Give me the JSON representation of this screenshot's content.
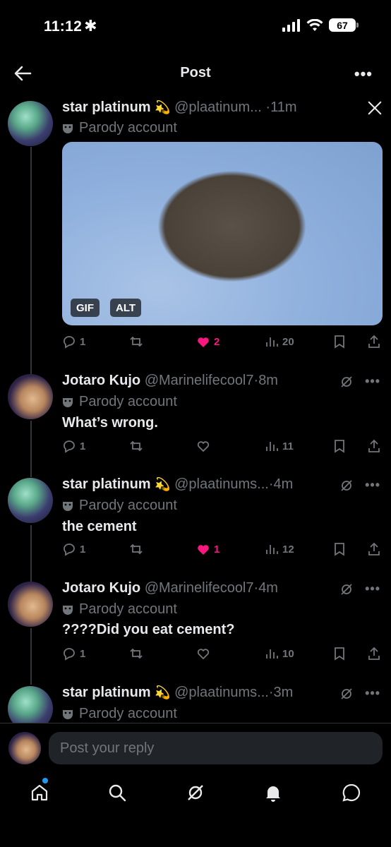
{
  "status_bar": {
    "time": "11:12",
    "battery": "67"
  },
  "header": {
    "title": "Post"
  },
  "posts": [
    {
      "name": "star platinum",
      "emoji": "💫",
      "handle": "@plaatinum...",
      "dot": "·",
      "time": "11m",
      "badge": "Parody account",
      "text": "",
      "media_badges": [
        "GIF",
        "ALT"
      ],
      "replies": "1",
      "reposts": "",
      "likes": "2",
      "views": "20"
    },
    {
      "name": "Jotaro Kujo",
      "emoji": "",
      "handle": "@Marinelifecool7",
      "dot": "·",
      "time": "8m",
      "badge": "Parody account",
      "text": "What’s wrong.",
      "replies": "1",
      "reposts": "",
      "likes": "",
      "views": "11"
    },
    {
      "name": "star platinum",
      "emoji": "💫",
      "handle": "@plaatinums...",
      "dot": "·",
      "time": "4m",
      "badge": "Parody account",
      "text": "the cement",
      "replies": "1",
      "reposts": "",
      "likes": "1",
      "views": "12"
    },
    {
      "name": "Jotaro Kujo",
      "emoji": "",
      "handle": "@Marinelifecool7",
      "dot": "·",
      "time": "4m",
      "badge": "Parody account",
      "text": "????Did you eat cement?",
      "replies": "1",
      "reposts": "",
      "likes": "",
      "views": "10"
    },
    {
      "name": "star platinum",
      "emoji": "💫",
      "handle": "@plaatinums...",
      "dot": "·",
      "time": "3m",
      "badge": "Parody account"
    }
  ],
  "reply_bar": {
    "placeholder": "Post your reply"
  },
  "icons": {
    "home": "home-icon",
    "search": "search-icon",
    "grok": "grok-icon",
    "notifications": "bell-icon",
    "messages": "message-icon"
  },
  "colors": {
    "like": "#f91880",
    "accent": "#1d9bf0",
    "muted": "#71767b"
  }
}
